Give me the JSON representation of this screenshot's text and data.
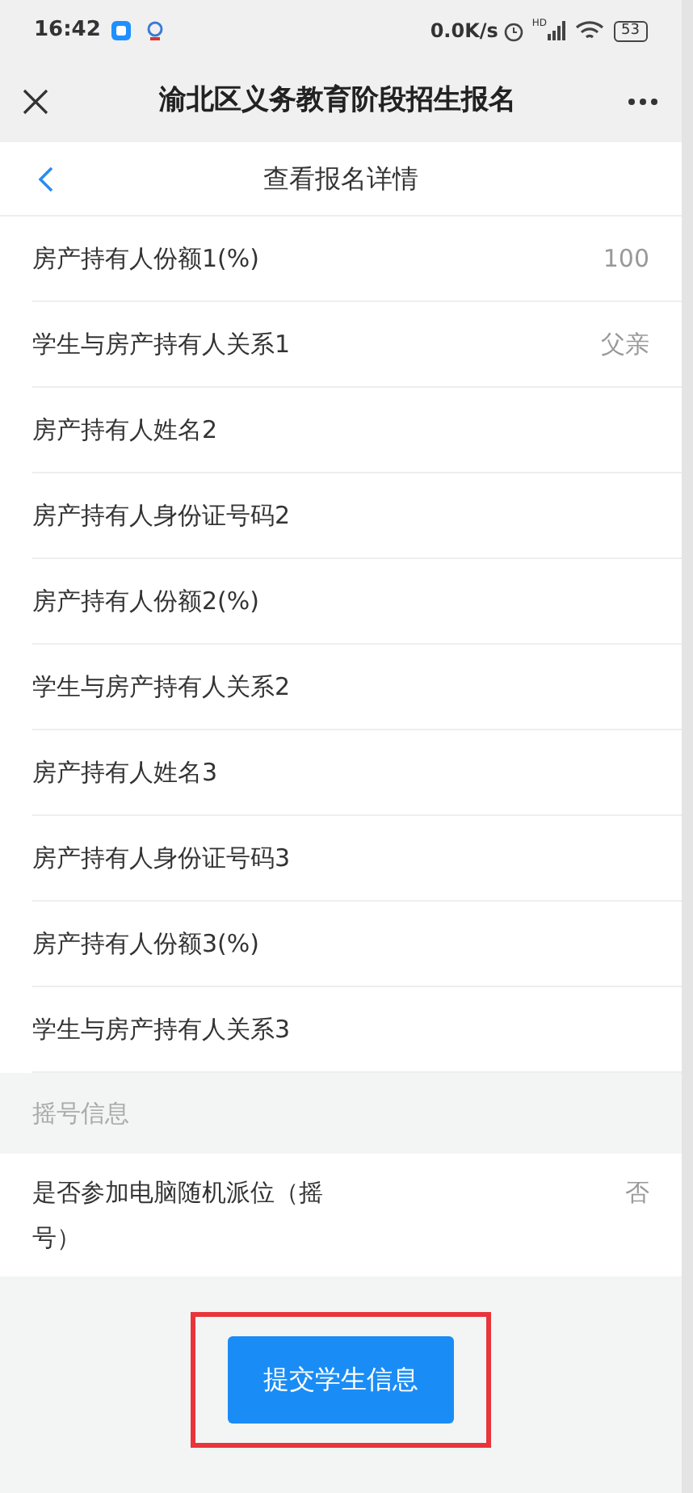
{
  "status_bar": {
    "time": "16:42",
    "speed": "0.0K/s",
    "network": "HD",
    "battery": "53"
  },
  "title_bar": {
    "title": "渝北区义务教育阶段招生报名"
  },
  "sub_header": {
    "title": "查看报名详情"
  },
  "rows": [
    {
      "label": "房产持有人份额1(%)",
      "value": "100"
    },
    {
      "label": "学生与房产持有人关系1",
      "value": "父亲"
    },
    {
      "label": "房产持有人姓名2"
    },
    {
      "label": "房产持有人身份证号码2"
    },
    {
      "label": "房产持有人份额2(%)"
    },
    {
      "label": "学生与房产持有人关系2"
    },
    {
      "label": "房产持有人姓名3"
    },
    {
      "label": "房产持有人身份证号码3"
    },
    {
      "label": "房产持有人份额3(%)"
    },
    {
      "label": "学生与房产持有人关系3"
    }
  ],
  "section": {
    "title": "摇号信息",
    "rows": [
      {
        "label": "是否参加电脑随机派位（摇号）",
        "value": "否"
      }
    ]
  },
  "submit_button": {
    "label": "提交学生信息",
    "highlighted": true
  }
}
